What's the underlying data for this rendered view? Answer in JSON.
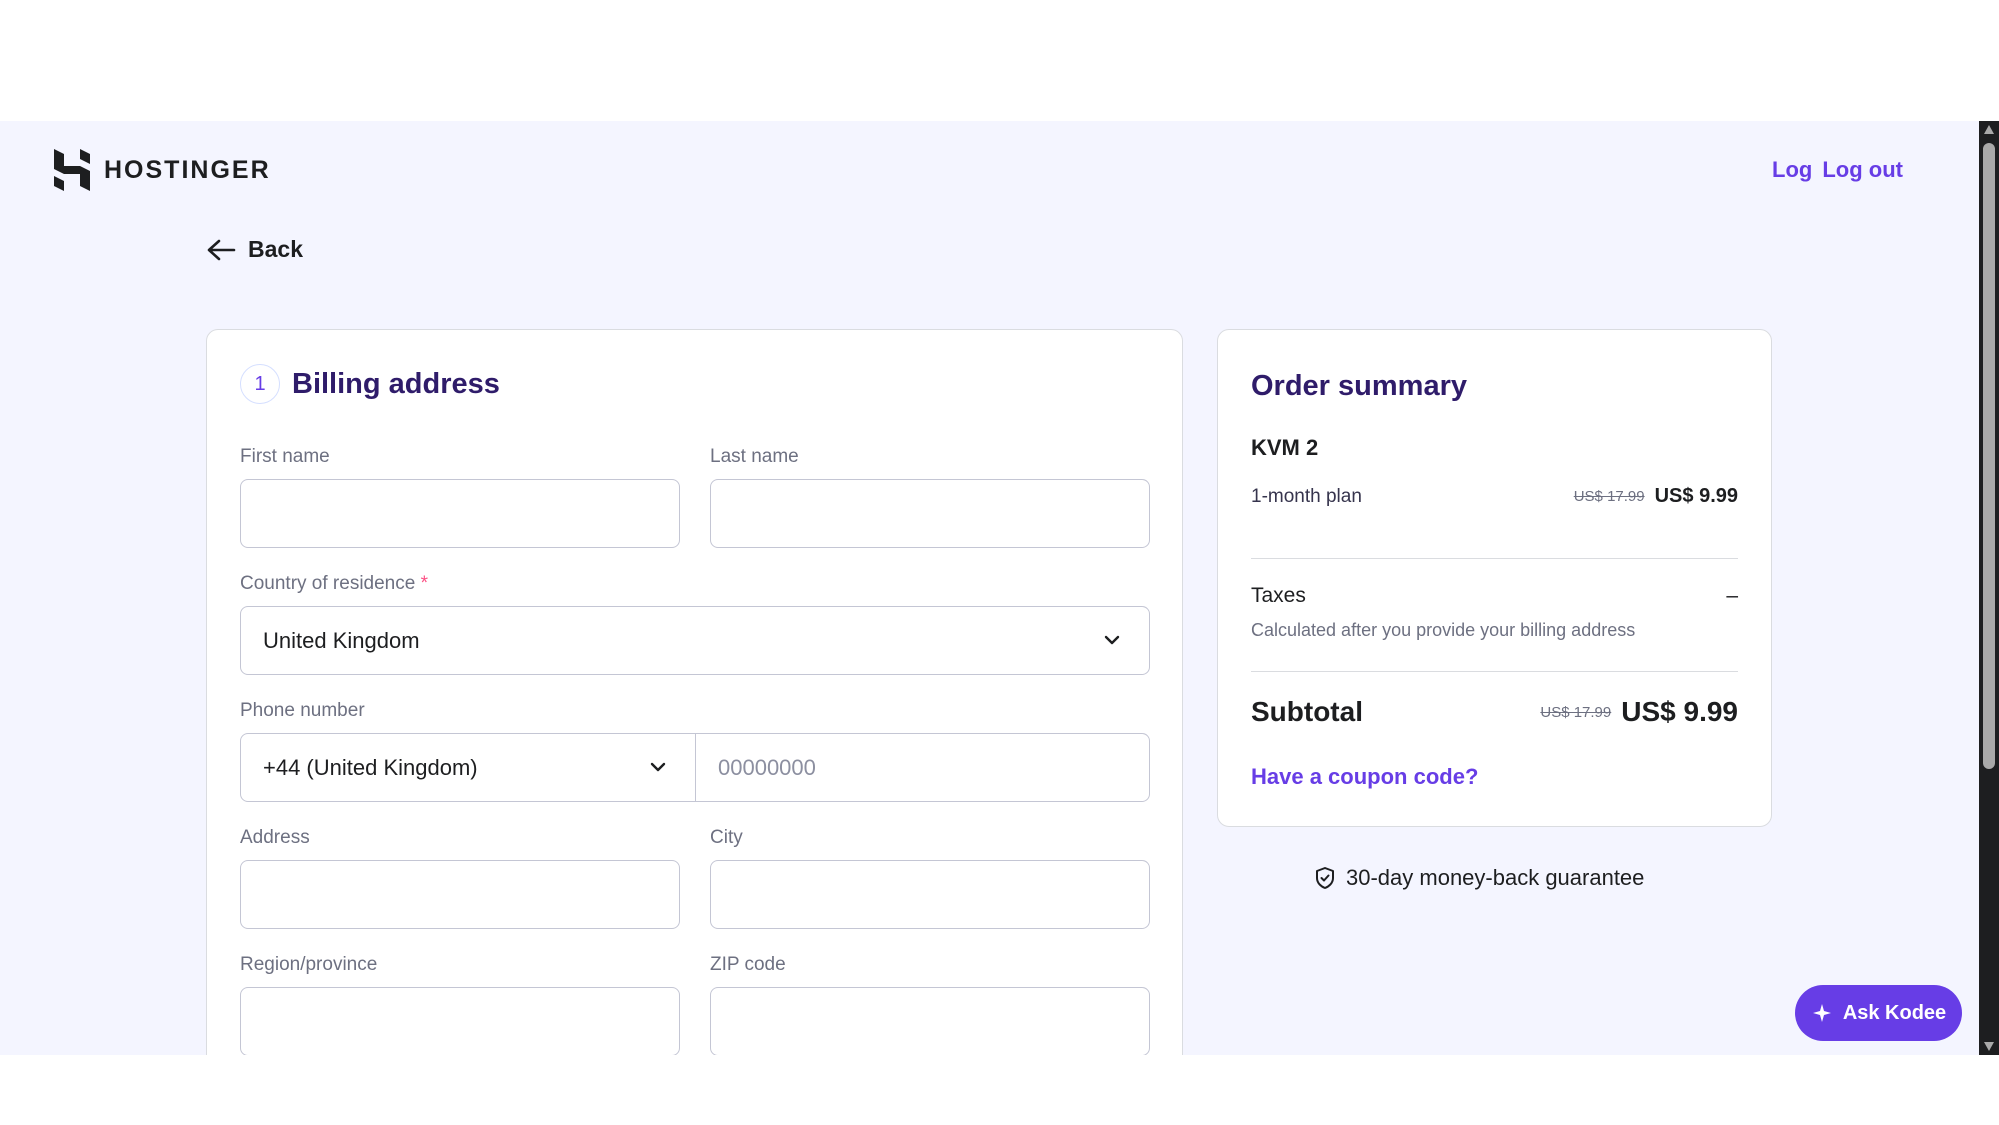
{
  "header": {
    "logo_text": "HOSTINGER",
    "link_log": "Log",
    "link_logout": "Log out"
  },
  "nav": {
    "back_label": "Back"
  },
  "billing": {
    "step_number": "1",
    "title": "Billing address",
    "first_name_label": "First name",
    "first_name_value": "",
    "last_name_label": "Last name",
    "last_name_value": "",
    "country_label": "Country of residence",
    "country_required_mark": "*",
    "country_value": "United Kingdom",
    "phone_label": "Phone number",
    "phone_code_value": "+44 (United Kingdom)",
    "phone_placeholder": "00000000",
    "address_label": "Address",
    "city_label": "City",
    "region_label": "Region/province",
    "zip_label": "ZIP code"
  },
  "summary": {
    "title": "Order summary",
    "plan_name": "KVM 2",
    "plan_term": "1-month plan",
    "plan_old_price": "US$ 17.99",
    "plan_price": "US$ 9.99",
    "taxes_label": "Taxes",
    "taxes_value": "–",
    "taxes_note": "Calculated after you provide your billing address",
    "subtotal_label": "Subtotal",
    "subtotal_old_price": "US$ 17.99",
    "subtotal_price": "US$ 9.99",
    "coupon_link": "Have a coupon code?"
  },
  "guarantee": {
    "text": "30-day money-back guarantee",
    "icon": "shield-check-icon"
  },
  "assistant": {
    "label": "Ask Kodee",
    "icon": "sparkle-icon"
  },
  "colors": {
    "accent": "#673de6",
    "page_bg": "#f4f5ff",
    "heading": "#2f1c6a"
  }
}
